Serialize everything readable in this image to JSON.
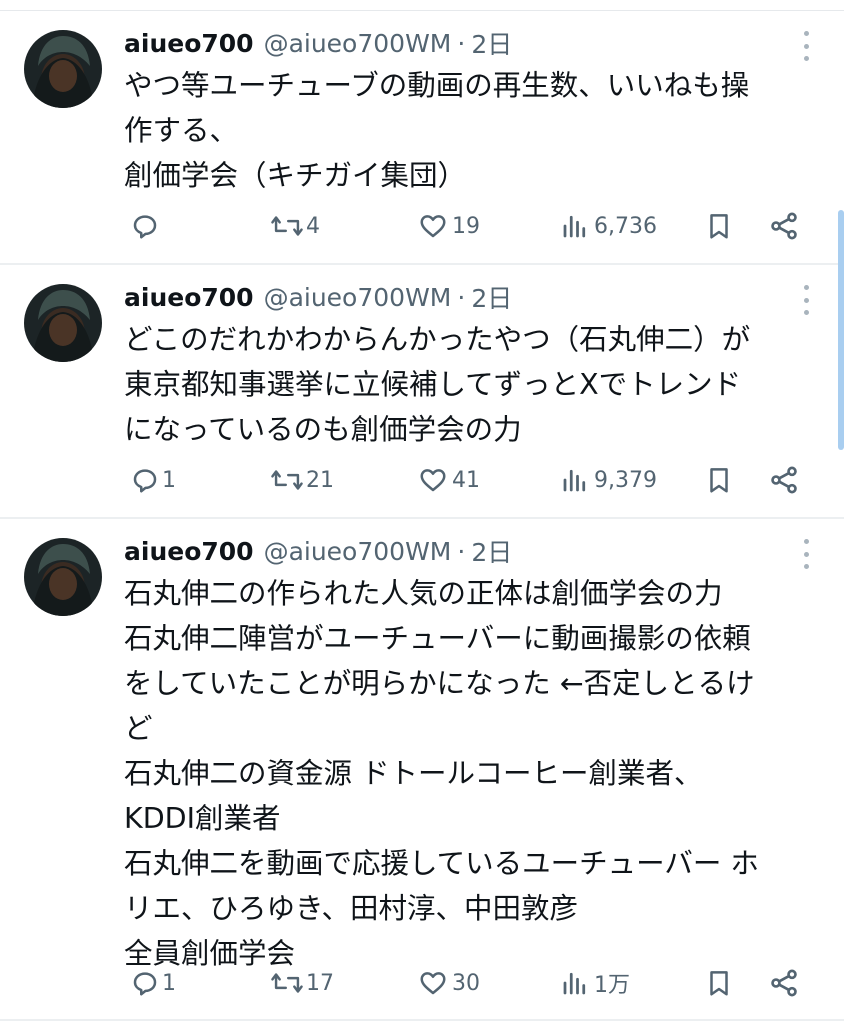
{
  "tweets": [
    {
      "display_name": "aiueo700",
      "handle": "@aiueo700WM",
      "separator": "·",
      "time": "2日",
      "lines": [
        "やつ等ユーチューブの動画の再生数、いいねも操",
        "作する、",
        "創価学会（キチガイ集団）"
      ],
      "replies": "",
      "retweets": "4",
      "likes": "19",
      "views": "6,736"
    },
    {
      "display_name": "aiueo700",
      "handle": "@aiueo700WM",
      "separator": "·",
      "time": "2日",
      "lines": [
        "どこのだれかわからんかったやつ（石丸伸二）が",
        "東京都知事選挙に立候補してずっとXでトレンド",
        "になっているのも創価学会の力"
      ],
      "replies": "1",
      "retweets": "21",
      "likes": "41",
      "views": "9,379"
    },
    {
      "display_name": "aiueo700",
      "handle": "@aiueo700WM",
      "separator": "·",
      "time": "2日",
      "lines": [
        "石丸伸二の作られた人気の正体は創価学会の力",
        "石丸伸二陣営がユーチューバーに動画撮影の依頼",
        "をしていたことが明らかになった ←否定しとるけ",
        "ど",
        "石丸伸二の資金源 ドトールコーヒー創業者、",
        "KDDI創業者",
        "石丸伸二を動画で応援しているユーチューバー ホ",
        "リエ、ひろゆき、田村淳、中田敦彦",
        "全員創価学会"
      ],
      "replies": "1",
      "retweets": "17",
      "likes": "30",
      "views": "1万"
    }
  ],
  "icons": {
    "reply": "speech-bubble-icon",
    "retweet": "retweet-arrows-icon",
    "like": "heart-outline-icon",
    "views": "bar-chart-icon",
    "bookmark": "bookmark-icon",
    "share": "share-nodes-icon",
    "more": "vertical-dots-icon"
  },
  "colors": {
    "text": "#0f1419",
    "secondary": "#536471",
    "divider": "#eceff1",
    "scrollbar": "#a9cef0"
  }
}
